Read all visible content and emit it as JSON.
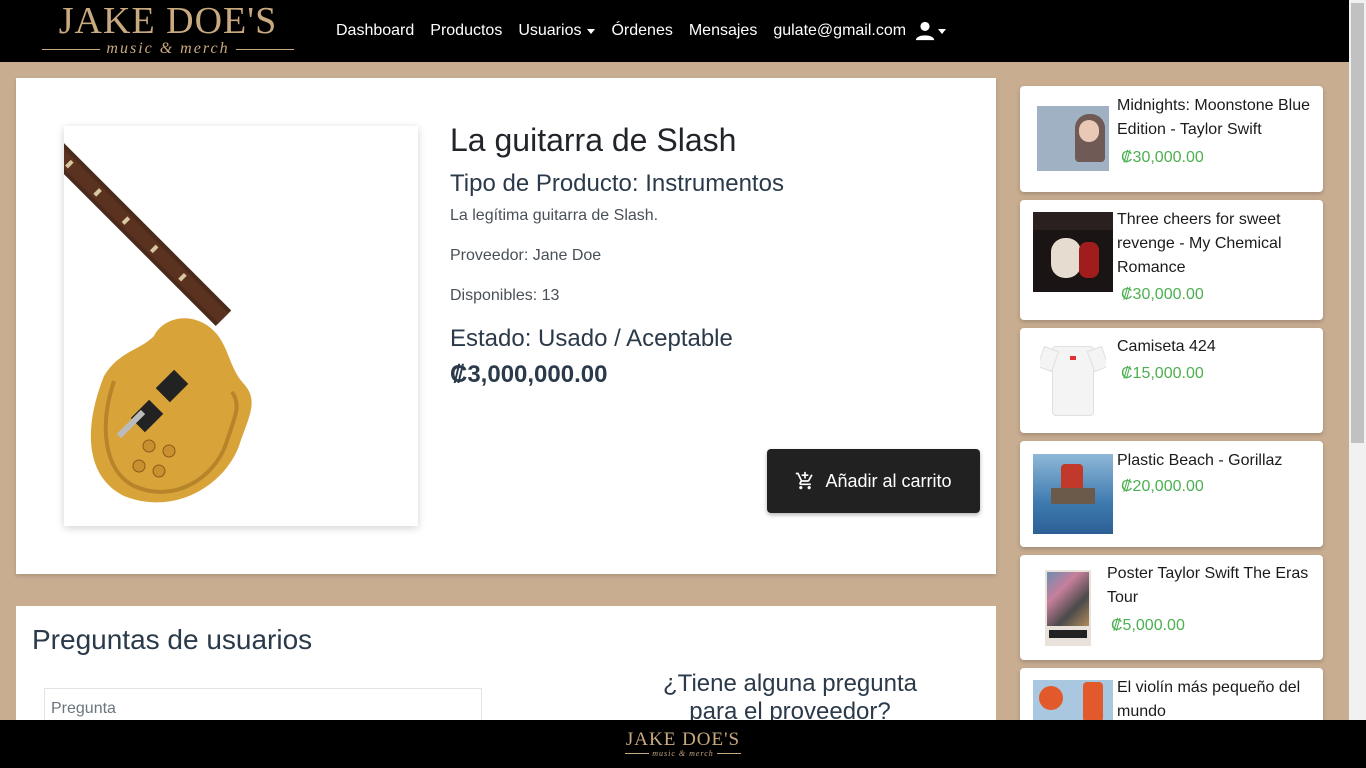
{
  "brand": {
    "name": "JAKE DOE'S",
    "tagline": "music & merch"
  },
  "nav": {
    "links": [
      "Dashboard",
      "Productos",
      "Usuarios",
      "Órdenes",
      "Mensajes"
    ],
    "user_email": "gulate@gmail.com"
  },
  "product": {
    "title": "La guitarra de Slash",
    "type": "Tipo de Producto: Instrumentos",
    "description": "La legítima guitarra de Slash.",
    "provider": "Proveedor: Jane Doe",
    "stock": "Disponibles: 13",
    "state": "Estado: Usado / Aceptable",
    "price": "₡3,000,000.00",
    "add_to_cart": "Añadir al carrito"
  },
  "questions": {
    "title": "Preguntas de usuarios",
    "input_placeholder": "Pregunta",
    "ask_heading_1": "¿Tiene alguna pregunta",
    "ask_heading_2": "para el proveedor?"
  },
  "sidebar": {
    "items": [
      {
        "name": "Midnights: Moonstone Blue Edition - Taylor Swift",
        "price": "₡30,000.00"
      },
      {
        "name": "Three cheers for sweet revenge - My Chemical Romance",
        "price": "₡30,000.00"
      },
      {
        "name": "Camiseta 424",
        "price": "₡15,000.00"
      },
      {
        "name": "Plastic Beach - Gorillaz",
        "price": "₡20,000.00"
      },
      {
        "name": "Poster Taylor Swift The Eras Tour",
        "price": "₡5,000.00"
      },
      {
        "name": "El violín más pequeño del mundo",
        "price": ""
      }
    ]
  },
  "colors": {
    "nav_bg": "#000000",
    "page_bg": "#c8ad91",
    "price_green": "#4caf50",
    "brand_gold": "#c9a97f"
  },
  "icons": {
    "user": "user-icon",
    "cart": "add-shopping-cart-icon"
  }
}
